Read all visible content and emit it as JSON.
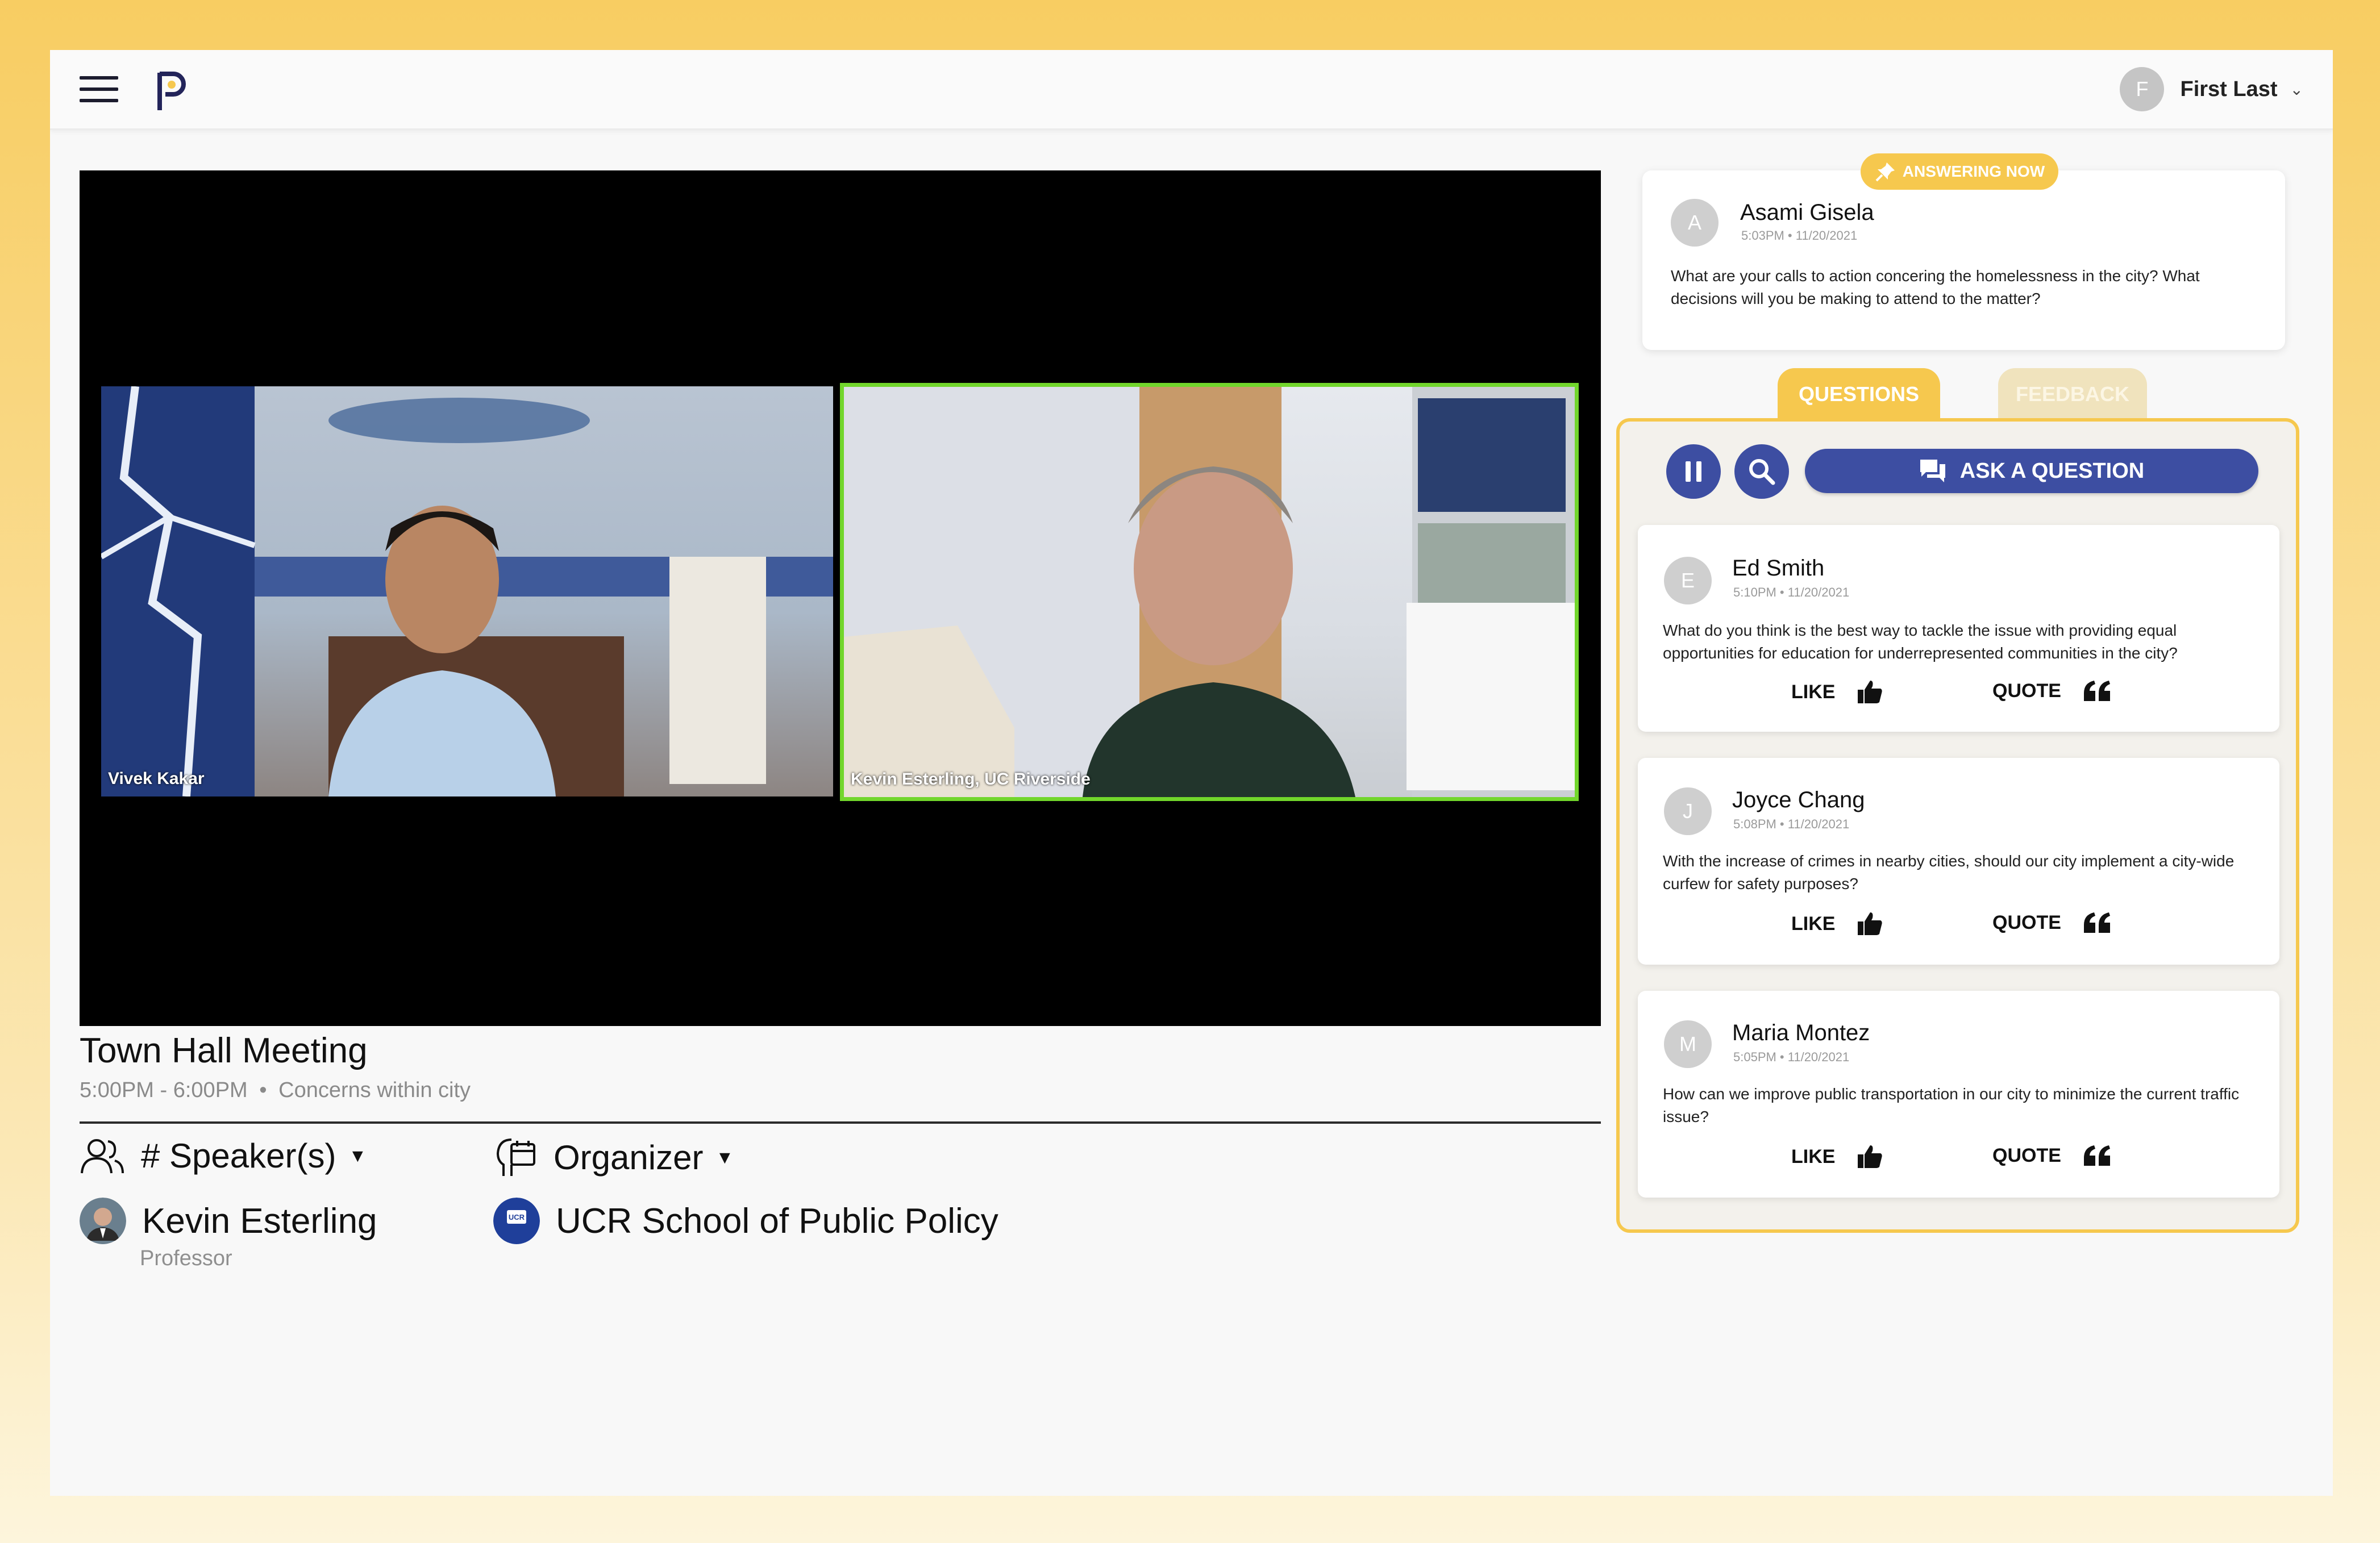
{
  "header": {
    "menu_icon": "hamburger-menu-icon",
    "logo_icon": "p-logo-icon",
    "user": {
      "initial": "F",
      "name": "First Last",
      "chevron_icon": "chevron-down-icon"
    }
  },
  "video": {
    "participants": [
      {
        "label": "Vivek Kakar",
        "active": false
      },
      {
        "label": "Kevin Esterling, UC Riverside",
        "active": true
      }
    ]
  },
  "meeting": {
    "title": "Town Hall Meeting",
    "time": "5:00PM - 6:00PM",
    "separator": "•",
    "topic": "Concerns within city",
    "speakers_label": "# Speaker(s)",
    "organizer_label": "Organizer",
    "speaker": {
      "name": "Kevin Esterling",
      "role": "Professor"
    },
    "organizer": {
      "name": "UCR School of Public Policy",
      "logo_text": "UCR"
    }
  },
  "answering_now": {
    "badge": "ANSWERING NOW",
    "initial": "A",
    "name": "Asami Gisela",
    "time": "5:03PM • 11/20/2021",
    "text": "What are your calls to action concering the homelessness in the city? What decisions will you be making to attend to the matter?"
  },
  "tabs": {
    "questions": "QUESTIONS",
    "feedback": "FEEDBACK",
    "active": "questions"
  },
  "toolbar": {
    "pause_icon": "pause-icon",
    "search_icon": "search-icon",
    "ask_label": "ASK A QUESTION",
    "ask_icon": "chat-icon"
  },
  "questions": [
    {
      "initial": "E",
      "name": "Ed Smith",
      "time": "5:10PM • 11/20/2021",
      "text": "What do you think is the best way to tackle the issue with providing equal opportunities for education for underrepresented communities in the city?",
      "like": "LIKE",
      "quote": "QUOTE"
    },
    {
      "initial": "J",
      "name": "Joyce Chang",
      "time": "5:08PM • 11/20/2021",
      "text": "With the increase of crimes in nearby cities, should our city implement a city-wide curfew for safety purposes?",
      "like": "LIKE",
      "quote": "QUOTE"
    },
    {
      "initial": "M",
      "name": "Maria Montez",
      "time": "5:05PM • 11/20/2021",
      "text": "How can we improve public transportation in our city to minimize the current traffic issue?",
      "like": "LIKE",
      "quote": "QUOTE"
    }
  ],
  "colors": {
    "accent_yellow": "#f6c84e",
    "brand_blue": "#3d4ea2",
    "active_speaker_border": "#72d62c"
  }
}
